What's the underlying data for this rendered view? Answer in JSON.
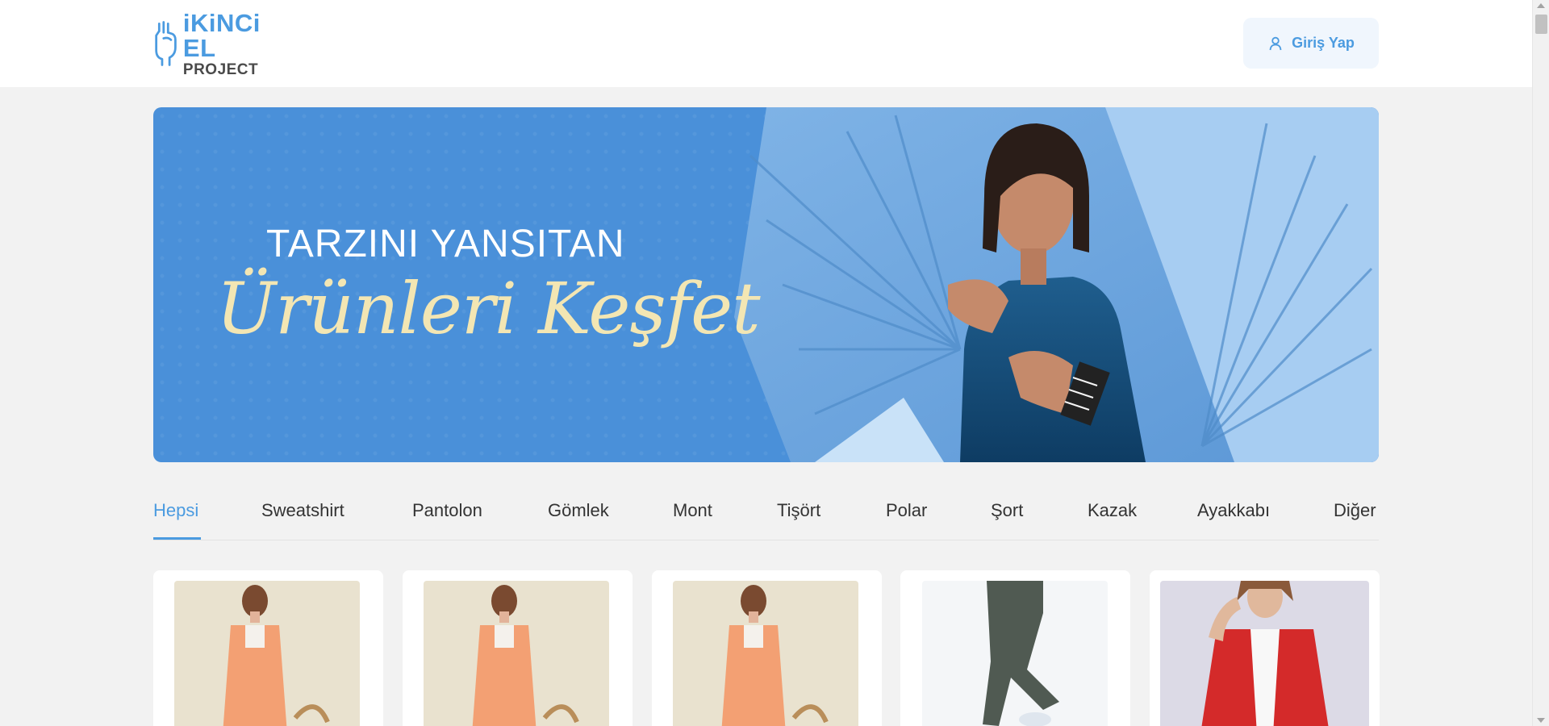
{
  "header": {
    "logo_top": "iKiNCi EL",
    "logo_bottom": "PROJECT",
    "login_label": "Giriş Yap"
  },
  "banner": {
    "line1": "TARZINI YANSITAN",
    "line2": "Ürünleri Keşfet"
  },
  "tabs": [
    {
      "label": "Hepsi",
      "active": true
    },
    {
      "label": "Sweatshirt"
    },
    {
      "label": "Pantolon"
    },
    {
      "label": "Gömlek"
    },
    {
      "label": "Mont"
    },
    {
      "label": "Tişört"
    },
    {
      "label": "Polar"
    },
    {
      "label": "Şort"
    },
    {
      "label": "Kazak"
    },
    {
      "label": "Ayakkabı"
    },
    {
      "label": "Diğer"
    }
  ],
  "colors": {
    "accent": "#4b9be0",
    "banner_bg": "#4a90d9",
    "banner_script": "#f3e6b3",
    "page_bg": "#f2f2f2"
  },
  "icons": {
    "login": "user-icon",
    "logo": "hand-logo-icon"
  }
}
